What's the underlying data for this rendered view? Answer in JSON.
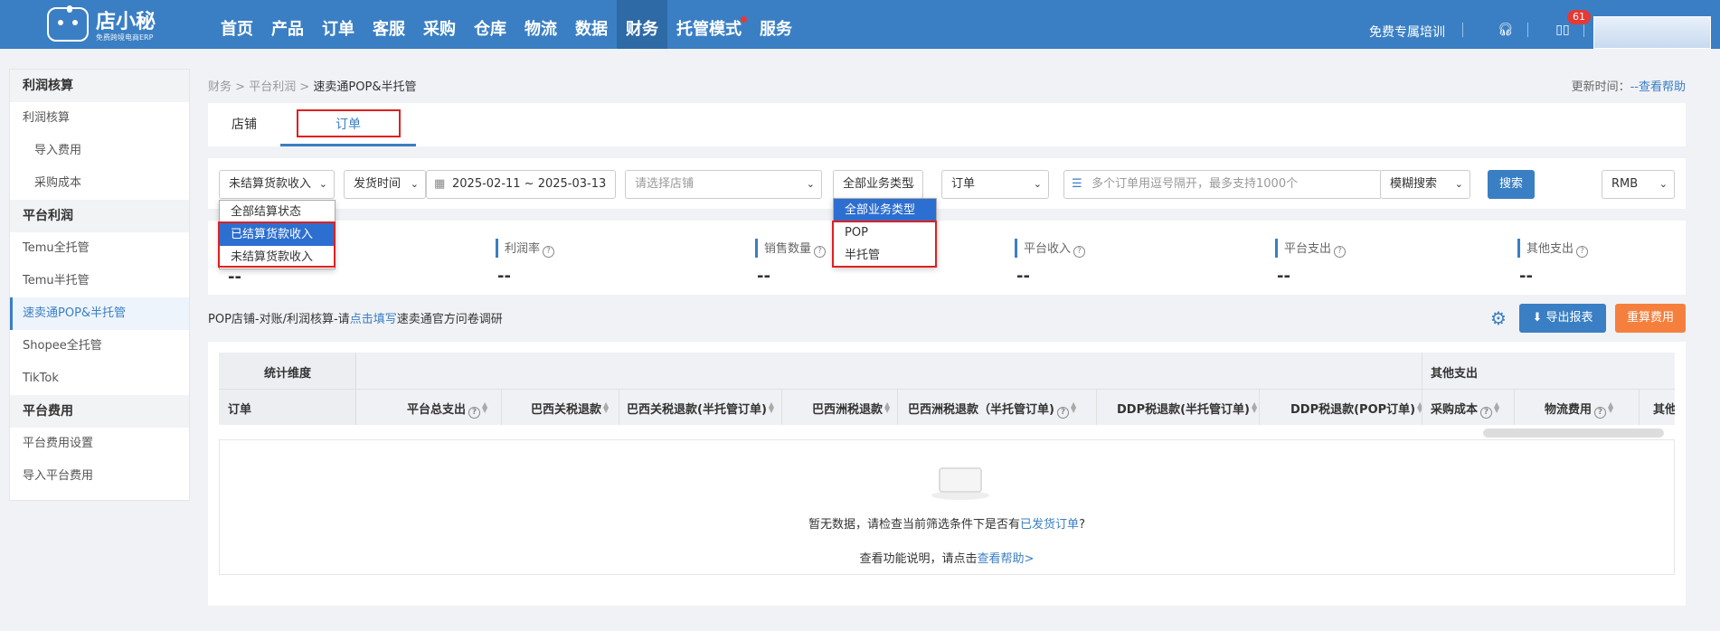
{
  "app": {
    "logo_name": "店小秘",
    "logo_sub": "免费跨境电商ERP"
  },
  "topnav": {
    "items": [
      "首页",
      "产品",
      "订单",
      "客服",
      "采购",
      "仓库",
      "物流",
      "数据",
      "财务",
      "托管模式",
      "服务"
    ],
    "active": "财务",
    "training": "免费专属培训",
    "notification_count": "61"
  },
  "sidebar": {
    "groups": [
      {
        "title": "利润核算",
        "items": [
          {
            "label": "利润核算",
            "sub": false
          },
          {
            "label": "导入费用",
            "sub": true
          },
          {
            "label": "采购成本",
            "sub": true
          }
        ]
      },
      {
        "title": "平台利润",
        "items": [
          {
            "label": "Temu全托管"
          },
          {
            "label": "Temu半托管"
          },
          {
            "label": "速卖通POP&半托管",
            "active": true
          },
          {
            "label": "Shopee全托管"
          },
          {
            "label": "TikTok"
          }
        ]
      },
      {
        "title": "平台费用",
        "items": [
          {
            "label": "平台费用设置"
          },
          {
            "label": "导入平台费用"
          }
        ]
      }
    ]
  },
  "breadcrumb": {
    "items": [
      "财务",
      "平台利润"
    ],
    "current": "速卖通POP&半托管",
    "sep": ">"
  },
  "update_time": {
    "label": "更新时间：",
    "value": "--",
    "help": "查看帮助"
  },
  "tabs": {
    "store": "店铺",
    "order": "订单"
  },
  "filters": {
    "settlement": "未结算货款收入",
    "time_type": "发货时间",
    "date_range": "2025-02-11 ~ 2025-03-13",
    "store_placeholder": "请选择店铺",
    "business_type": "全部业务类型",
    "order_type": "订单",
    "search_placeholder": "多个订单用逗号隔开，最多支持1000个",
    "search_mode": "模糊搜索",
    "search_button": "搜索",
    "currency": "RMB"
  },
  "settlement_dropdown": {
    "options": [
      "全部结算状态",
      "已结算货款收入",
      "未结算货款收入"
    ],
    "highlighted": "已结算货款收入"
  },
  "business_dropdown": {
    "options": [
      "全部业务类型",
      "POP",
      "半托管"
    ],
    "highlighted": "全部业务类型"
  },
  "stats": [
    {
      "label": "",
      "value": "--"
    },
    {
      "label": "利润率",
      "value": "--"
    },
    {
      "label": "销售数量",
      "value": "--"
    },
    {
      "label": "平台收入",
      "value": "--"
    },
    {
      "label": "平台支出",
      "value": "--"
    },
    {
      "label": "其他支出",
      "value": "--"
    }
  ],
  "notice": {
    "prefix": "POP店铺-对账/利润核算-请",
    "link": "点击填写",
    "suffix": "速卖通官方问卷调研"
  },
  "actions": {
    "export": "导出报表",
    "recalc": "重算费用"
  },
  "table": {
    "group_left": "统计维度",
    "group_right": "其他支出",
    "columns": [
      "订单",
      "平台总支出",
      "巴西关税退款",
      "巴西关税退款(半托管订单)",
      "巴西洲税退款",
      "巴西洲税退款（半托管订单)",
      "DDP税退款(半托管订单)",
      "DDP税退款(POP订单)",
      "采购成本",
      "物流费用",
      "其他"
    ]
  },
  "empty": {
    "line1_prefix": "暂无数据，请检查当前筛选条件下是否有",
    "line1_link": "已发货订单",
    "line1_suffix": "?",
    "line2_prefix": "查看功能说明，请点击",
    "line2_link": "查看帮助>"
  },
  "colors": {
    "nav": "#3a7fc4",
    "primary": "#3a7fc4",
    "orange": "#f5803e",
    "highlight": "#2d6fd0",
    "annotation": "#e02020"
  }
}
